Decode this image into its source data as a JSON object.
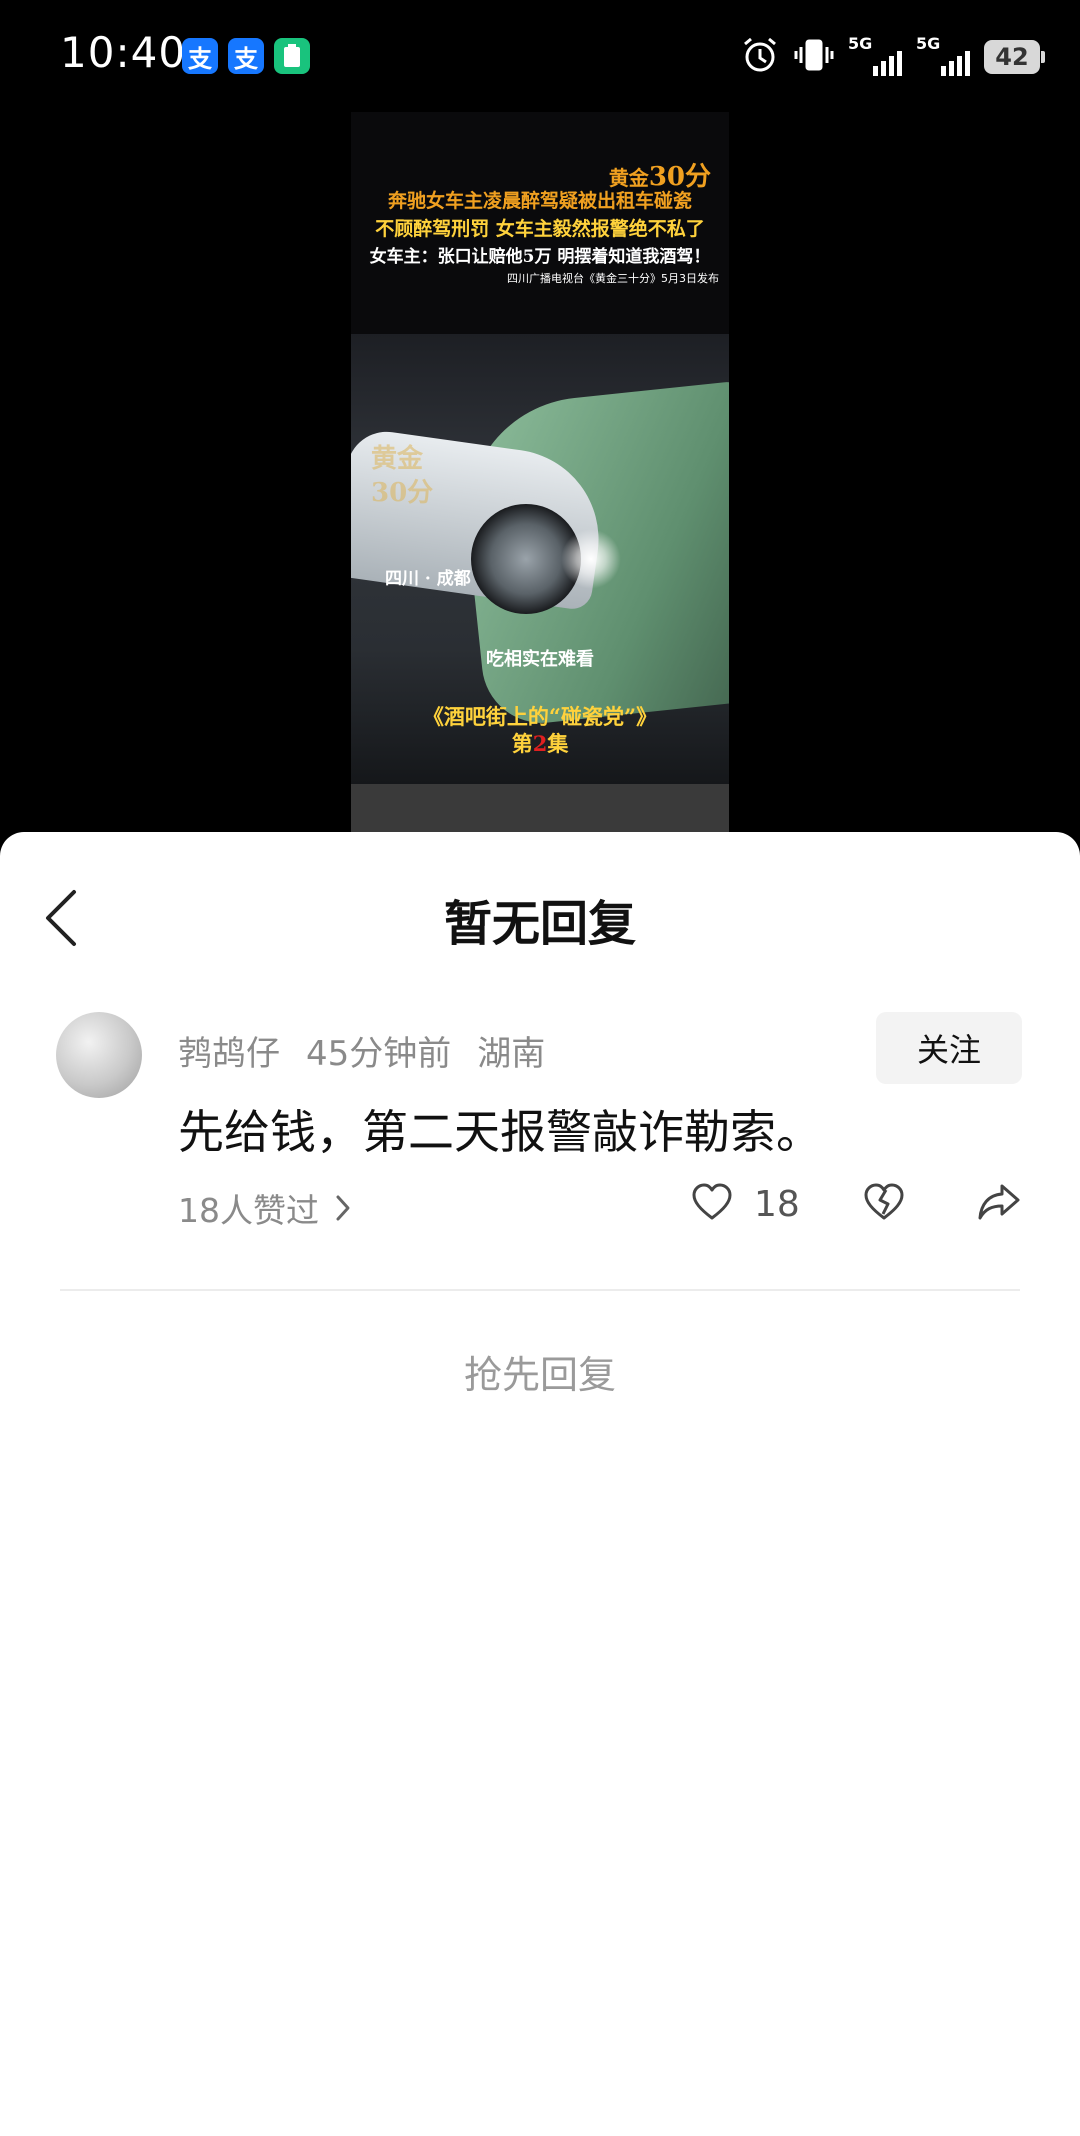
{
  "status_bar": {
    "time": "10:40",
    "app_icons": [
      "支",
      "支"
    ],
    "signal1_label": "5G",
    "signal2_label": "5G",
    "battery": "42"
  },
  "video": {
    "logo_prefix": "黄金",
    "logo_num": "30分",
    "headline1": "奔驰女车主凌晨醉驾疑被出租车碰瓷",
    "headline2": "不顾醉驾刑罚 女车主毅然报警绝不私了",
    "headline3": "女车主：张口让赔他5万 明摆着知道我酒驾！",
    "source": "四川广播电视台《黄金三十分》5月3日发布",
    "watermark_line1": "黄金",
    "watermark_line2": "30分",
    "location": "四川 · 成都",
    "subtitle": "吃相实在难看",
    "series_title": "《酒吧街上的“碰瓷党”》",
    "episode_prefix": "第",
    "episode_num": "2",
    "episode_suffix": "集",
    "colors": {
      "orange": "#f0a020",
      "yellow": "#ffd23c",
      "red": "#e02020"
    }
  },
  "sheet": {
    "title": "暂无回复",
    "comment": {
      "username": "鹁鸪仔",
      "time_ago": "45分钟前",
      "location": "湖南",
      "follow_label": "关注",
      "text": "先给钱，第二天报警敲诈勒索。",
      "likers_text": "18人赞过",
      "like_count": "18"
    },
    "reply_first": "抢先回复"
  }
}
